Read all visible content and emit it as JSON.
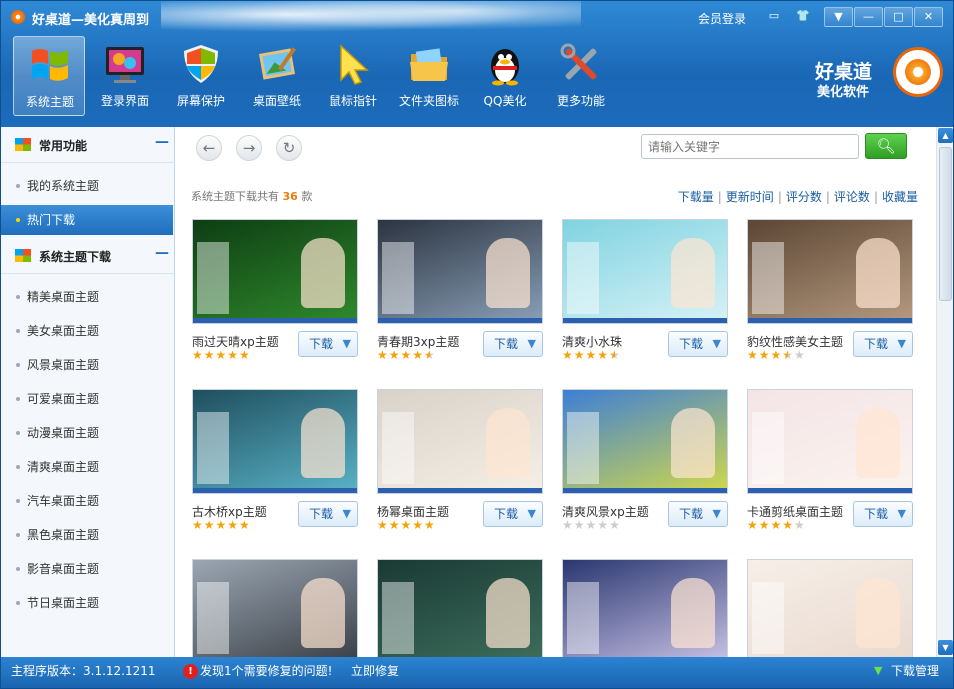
{
  "app": {
    "title": "好桌道—美化真周到",
    "login": "会员登录",
    "window_buttons": [
      "▼",
      "—",
      "□",
      "✕"
    ]
  },
  "toolbar": [
    {
      "label": "系统主题",
      "icon": "windows-icon",
      "active": true
    },
    {
      "label": "登录界面",
      "icon": "monitor-icon",
      "active": false
    },
    {
      "label": "屏幕保护",
      "icon": "shield-icon",
      "active": false
    },
    {
      "label": "桌面壁纸",
      "icon": "wallpaper-icon",
      "active": false
    },
    {
      "label": "鼠标指针",
      "icon": "cursor-icon",
      "active": false
    },
    {
      "label": "文件夹图标",
      "icon": "folder-icon",
      "active": false
    },
    {
      "label": "QQ美化",
      "icon": "penguin-icon",
      "active": false
    },
    {
      "label": "更多功能",
      "icon": "tools-icon",
      "active": false
    }
  ],
  "brand": {
    "line1": "好桌道",
    "line2": "美化软件"
  },
  "sidebar": {
    "section1": {
      "title": "常用功能",
      "items": [
        {
          "label": "我的系统主题",
          "active": false
        },
        {
          "label": "热门下载",
          "active": true
        }
      ]
    },
    "section2": {
      "title": "系统主题下载",
      "items": [
        {
          "label": "精美桌面主题"
        },
        {
          "label": "美女桌面主题"
        },
        {
          "label": "风景桌面主题"
        },
        {
          "label": "可爱桌面主题"
        },
        {
          "label": "动漫桌面主题"
        },
        {
          "label": "清爽桌面主题"
        },
        {
          "label": "汽车桌面主题"
        },
        {
          "label": "黑色桌面主题"
        },
        {
          "label": "影音桌面主题"
        },
        {
          "label": "节日桌面主题"
        }
      ]
    }
  },
  "content": {
    "search_placeholder": "请输入关键字",
    "count_prefix": "系统主题下载共有",
    "count": "36",
    "count_suffix": "款",
    "sort_options": [
      "下载量",
      "更新时间",
      "评分数",
      "评论数",
      "收藏量"
    ],
    "download_label": "下载",
    "themes": [
      {
        "name": "雨过天晴xp主题",
        "rating": 5,
        "colors": [
          "#0e3d14",
          "#2f8a2c"
        ]
      },
      {
        "name": "青春期3xp主题",
        "rating": 4.5,
        "colors": [
          "#2c3440",
          "#8aa0b8"
        ]
      },
      {
        "name": "清爽小水珠",
        "rating": 4.5,
        "colors": [
          "#7fd3e0",
          "#d8f2f6"
        ]
      },
      {
        "name": "豹纹性感美女主题",
        "rating": 3.5,
        "colors": [
          "#5c4634",
          "#b59a80"
        ]
      },
      {
        "name": "古木桥xp主题",
        "rating": 5,
        "colors": [
          "#1f4f5e",
          "#5ab3c8"
        ]
      },
      {
        "name": "杨幂桌面主题",
        "rating": 5,
        "colors": [
          "#d8d2c8",
          "#f5efe6"
        ]
      },
      {
        "name": "清爽风景xp主题",
        "rating": 0,
        "colors": [
          "#3d7fd6",
          "#d2d84a"
        ]
      },
      {
        "name": "卡通剪纸桌面主题",
        "rating": 4,
        "colors": [
          "#f4e4e6",
          "#fbf3f0"
        ]
      },
      {
        "name": "",
        "rating": 0,
        "colors": [
          "#9aa6b2",
          "#3a3f46"
        ]
      },
      {
        "name": "",
        "rating": 0,
        "colors": [
          "#1a3a34",
          "#3d6e5c"
        ]
      },
      {
        "name": "",
        "rating": 0,
        "colors": [
          "#2a3770",
          "#c9c2e6"
        ]
      },
      {
        "name": "",
        "rating": 0,
        "colors": [
          "#f6efe8",
          "#e9d9cf"
        ]
      }
    ]
  },
  "status": {
    "version": "主程序版本：3.1.12.1211",
    "warning": "发现1个需要修复的问题!",
    "fix": "立即修复",
    "download_manager": "下载管理"
  }
}
